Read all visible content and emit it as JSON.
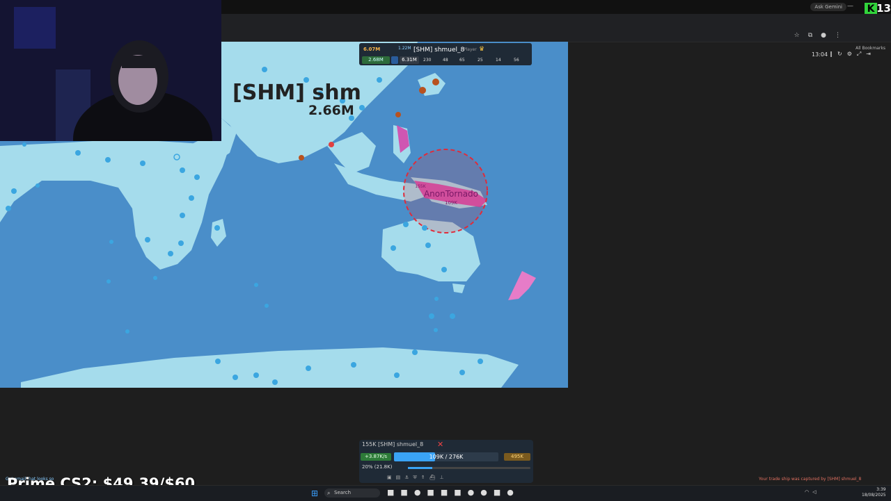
{
  "browser": {
    "gemini_label": "Ask Gemini",
    "bookmarks_label": "All Bookmarks",
    "kick_logo": "K",
    "kick_count": "13"
  },
  "hud": {
    "target_name": "[SHM] shm",
    "target_troops": "2.66M",
    "timer": "13:04"
  },
  "player_card": {
    "gold": "6.07M",
    "troops_small": "1.22M",
    "name": "[SHM] shmuel_8",
    "tag": "Player",
    "pill_troops": "2.68M",
    "pill_max": "6.31M",
    "stats": [
      "230",
      "48",
      "65",
      "25",
      "14",
      "56"
    ]
  },
  "map_labels": {
    "enemy_name": "AnonTornado",
    "enemy_troops": "109K",
    "enemy_small": "155K"
  },
  "bottom_panel": {
    "header": "155K [SHM] shmuel_8",
    "close": "✕",
    "rate": "+3.87K/s",
    "troops": "109K / 276K",
    "troops_fraction": 0.395,
    "gold": "495K",
    "attack": "20% (21.8K)",
    "attack_fraction": 0.2
  },
  "overlay": {
    "prime_text": "Prime CS2: $49.39/$60",
    "ghost_text": "Get email that looks so",
    "trade_msg": "Your trade ship was captured by [SHM] shmuel_8"
  },
  "taskbar": {
    "search_label": "Search",
    "clock_time": "3:39",
    "clock_date": "18/08/2025"
  },
  "colors": {
    "ocean": "#4a8ec9",
    "land": "#a5dcec",
    "player_blue": "#3ba6e0",
    "enemy_pink": "#d63ea8",
    "enemy_circle": "#e02b3a"
  }
}
